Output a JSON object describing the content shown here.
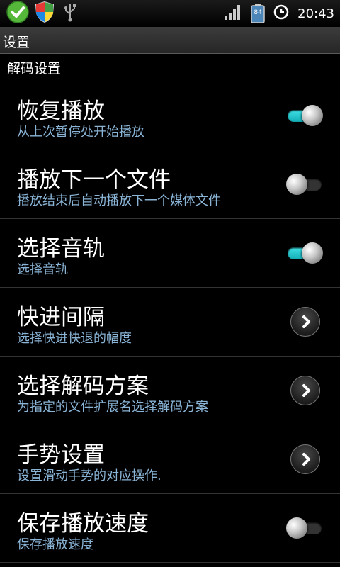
{
  "status_bar": {
    "time": "20:43",
    "battery_level": "84",
    "icons": [
      "check-circle-icon",
      "shield-icon",
      "usb-icon",
      "signal-icon",
      "battery-icon",
      "clock-icon"
    ]
  },
  "title_bar": {
    "title": "设置"
  },
  "category": {
    "label": "解码设置"
  },
  "items": [
    {
      "title": "恢复播放",
      "summary": "从上次暂停处开始播放",
      "control": "toggle",
      "checked": true
    },
    {
      "title": "播放下一个文件",
      "summary": "播放结束后自动播放下一个媒体文件",
      "control": "toggle",
      "checked": false
    },
    {
      "title": "选择音轨",
      "summary": "选择音轨",
      "control": "toggle",
      "checked": true
    },
    {
      "title": "快进间隔",
      "summary": "选择快进快退的幅度",
      "control": "chevron"
    },
    {
      "title": "选择解码方案",
      "summary": "为指定的文件扩展名选择解码方案",
      "control": "chevron"
    },
    {
      "title": "手势设置",
      "summary": "设置滑动手势的对应操作.",
      "control": "chevron"
    },
    {
      "title": "保存播放速度",
      "summary": "保存播放速度",
      "control": "toggle",
      "checked": false
    }
  ],
  "colors": {
    "summary": "#8ab4d6",
    "toggle_on": "#2cc8d0",
    "background": "#000000"
  }
}
